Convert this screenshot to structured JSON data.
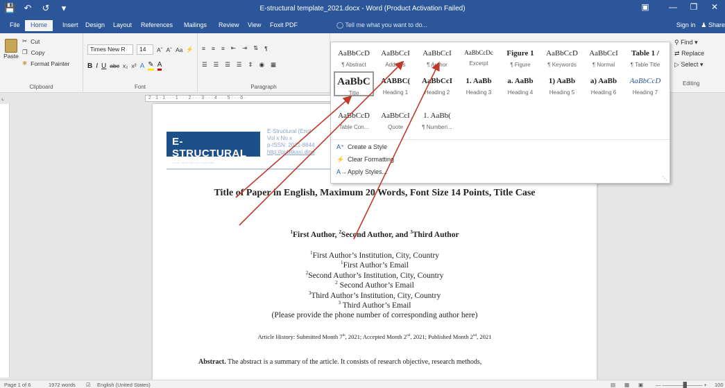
{
  "window": {
    "title": "E-structural template_2021.docx - Word (Product Activation Failed)",
    "controls": [
      "restore-icon",
      "minimize-icon",
      "maximize-icon",
      "close-icon"
    ]
  },
  "qat": {
    "save_icon": "💾",
    "undo_icon": "↶",
    "redo_icon": "↺",
    "more_icon": "▾"
  },
  "tabs": [
    "File",
    "Home",
    "Insert",
    "Design",
    "Layout",
    "References",
    "Mailings",
    "Review",
    "View",
    "Foxit PDF"
  ],
  "tell_me": "Tell me what you want to do...",
  "sign_in": "Sign in",
  "share": "Share",
  "clipboard": {
    "paste": "Paste",
    "cut": "Cut",
    "copy": "Copy",
    "format_painter": "Format Painter",
    "group_label": "Clipboard"
  },
  "font": {
    "name": "Times New R",
    "size": "14",
    "aa": "Aa",
    "group_label": "Font"
  },
  "paragraph": {
    "group_label": "Paragraph"
  },
  "styles": {
    "row1": [
      {
        "preview": "AaBbCcD",
        "name": "¶ Abstract"
      },
      {
        "preview": "AaBbCcI",
        "name": "Address"
      },
      {
        "preview": "AaBbCcI",
        "name": "¶ Author"
      },
      {
        "preview": "AaBbCcDc",
        "name": "Excerpt"
      },
      {
        "preview": "Figure 1",
        "name": "¶ Figure"
      },
      {
        "preview": "AaBbCcD",
        "name": "¶ Keywords"
      },
      {
        "preview": "AaBbCcI",
        "name": "¶ Normal"
      },
      {
        "preview": "Table 1 /",
        "name": "¶ Table Title"
      }
    ],
    "row2": [
      {
        "preview": "AaBbC",
        "name": "Title"
      },
      {
        "preview": "AABBC(",
        "name": "Heading 1"
      },
      {
        "preview": "AaBbCcI",
        "name": "Heading 2"
      },
      {
        "preview": "1. AaBb",
        "name": "Heading 3"
      },
      {
        "preview": "a. AaBb",
        "name": "Heading 4"
      },
      {
        "preview": "1) AaBb",
        "name": "Heading 5"
      },
      {
        "preview": "a) AaBb",
        "name": "Heading 6"
      },
      {
        "preview": "AaBbCcD",
        "name": "Heading 7"
      }
    ],
    "row3": [
      {
        "preview": "AaBbCcD",
        "name": "Table Con..."
      },
      {
        "preview": "AaBbCcI",
        "name": "Quote"
      },
      {
        "preview": "1. AaBb(",
        "name": "¶ Numberi..."
      }
    ],
    "commands": [
      "Create a Style",
      "Clear Formatting",
      "Apply Styles..."
    ]
  },
  "editing": {
    "find": "Find",
    "replace": "Replace",
    "select": "Select",
    "group_label": "Editing"
  },
  "ruler_text": "2 · 1 · 1 · · · 1 · · · 2 · · · 3 · · · 4 · · · 5 · · · 6 ·",
  "document": {
    "logo": "E-STRUCTURAL",
    "header_lines": [
      "E-Structural (Engl",
      "Vol x No x",
      "p-ISSN: 2021-8844",
      "http://publikasi.dinu"
    ],
    "title": "Title of Paper in English, Maximum 20 Words, Font Size 14 Points, Title Case",
    "authors": [
      "First Author, ",
      "Second Author, and ",
      "Third Author"
    ],
    "author_sups": [
      "1",
      "2",
      "3"
    ],
    "affiliations": [
      {
        "sup": "1",
        "text": "First Author’s Institution, City, Country"
      },
      {
        "sup": "1",
        "text": "First Author’s Email"
      },
      {
        "sup": "2",
        "text": "Second Author’s Institution, City, Country"
      },
      {
        "sup": "2",
        "text": " Second Author’s Email"
      },
      {
        "sup": "3",
        "text": "Third Author’s Institution, City, Country"
      },
      {
        "sup": "3",
        "text": " Third Author’s Email"
      }
    ],
    "phone_note": "(Please provide the phone number of corresponding author here)",
    "history": {
      "prefix": "Article History: Submitted Month 7",
      "sup1": "th",
      "mid1": ", 2021; Accepted Month 2",
      "sup2": "nd",
      "mid2": ", 2021; Published Month 2",
      "sup3": "nd",
      "suffix": ", 2021"
    },
    "abstract_label": "Abstract.",
    "abstract_text": " The abstract is a summary of the article. It consists of research objective, research methods,"
  },
  "status": {
    "page": "Page 1 of 6",
    "words": "1972 words",
    "language": "English (United States)",
    "zoom": "100"
  }
}
